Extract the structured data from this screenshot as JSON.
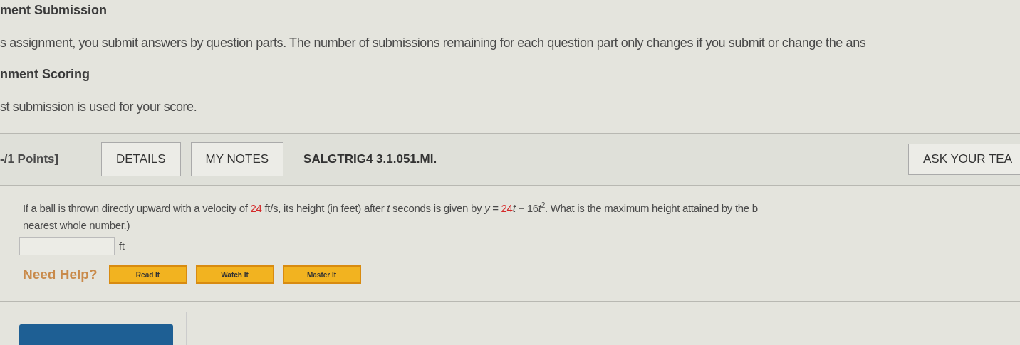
{
  "sections": [
    {
      "heading": "ment Submission",
      "text": "s assignment, you submit answers by question parts. The number of submissions remaining for each question part only changes if you submit or change the ans"
    },
    {
      "heading": "nment Scoring",
      "text": "st submission is used for your score."
    }
  ],
  "question": {
    "points": "-/1 Points]",
    "buttons": [
      "DETAILS",
      "MY NOTES"
    ],
    "code": "SALGTRIG4 3.1.051.MI.",
    "ask_button": "ASK YOUR TEA",
    "lines": [
      [
        {
          "kind": "plain",
          "text": "If a ball is thrown directly upward with a velocity of "
        },
        {
          "kind": "highlight",
          "text": "24"
        },
        {
          "kind": "plain",
          "text": " ft/s, its height (in feet) after "
        },
        {
          "kind": "var",
          "text": "t"
        },
        {
          "kind": "plain",
          "text": " seconds is given by "
        },
        {
          "kind": "var",
          "text": "y"
        },
        {
          "kind": "plain",
          "text": " = "
        },
        {
          "kind": "highlight",
          "text": "24"
        },
        {
          "kind": "var",
          "text": "t"
        },
        {
          "kind": "plain",
          "text": " − 16"
        },
        {
          "kind": "var",
          "text": "t"
        },
        {
          "kind": "sup",
          "text": "2"
        },
        {
          "kind": "plain",
          "text": ". What is the maximum height attained by the b"
        }
      ],
      [
        {
          "kind": "plain",
          "text": "nearest whole number.)"
        }
      ]
    ],
    "unit": "ft",
    "help_label": "Need Help?",
    "help_buttons": [
      "Read It",
      "Watch It",
      "Master It"
    ]
  }
}
